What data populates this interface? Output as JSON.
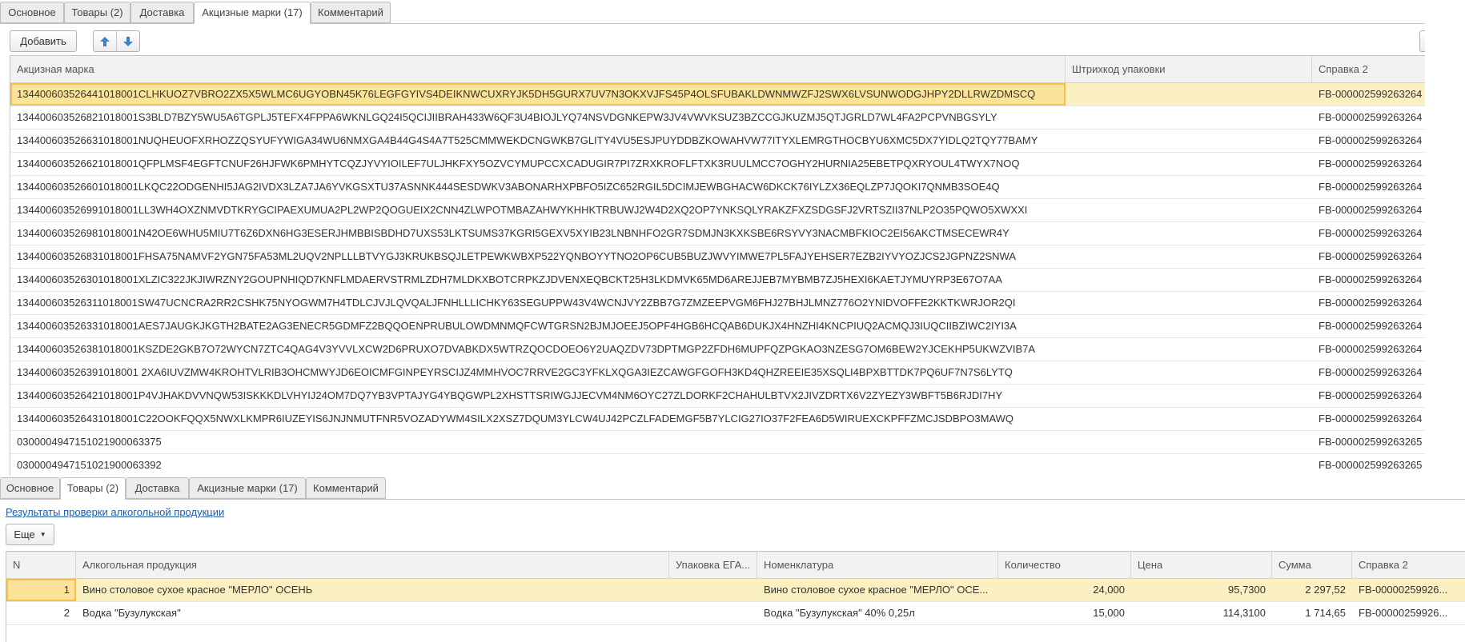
{
  "top": {
    "tabs": [
      "Основное",
      "Товары (2)",
      "Доставка",
      "Акцизные марки (17)",
      "Комментарий"
    ],
    "add_label": "Добавить",
    "icons": {
      "up": "arrow-up-icon",
      "down": "arrow-down-icon"
    },
    "columns": {
      "mark": "Акцизная марка",
      "barcode": "Штрихкод упаковки",
      "ref": "Справка 2"
    },
    "rows": [
      {
        "mark": "134400603526441018001CLHKUOZ7VBRO2ZX5X5WLMC6UGYOBN45K76LEGFGYIVS4DEIKNWCUXRYJK5DH5GURX7UV7N3OKXVJFS45P4OLSFUBAKLDWNMWZFJ2SWX6LVSUNWODGJHPY2DLLRWZDMSCQ",
        "barcode": "",
        "ref": "FB-000002599263264"
      },
      {
        "mark": "134400603526821018001S3BLD7BZY5WU5A6TGPLJ5TEFX4FPPA6WKNLGQ24I5QCIJIIBRAH433W6QF3U4BIOJLYQ74NSVDGNKEPW3JV4VWVKSUZ3BZCCGJKUZMJ5QTJGRLD7WL4FA2PCPVNBGSYLY",
        "barcode": "",
        "ref": "FB-000002599263264"
      },
      {
        "mark": "134400603526631018001NUQHEUOFXRHOZZQSYUFYWIGA34WU6NMXGA4B44G4S4A7T525CMMWEKDCNGWKB7GLITY4VU5ESJPUYDDBZKOWAHVW77ITYXLEMRGTHOCBYU6XMC5DX7YIDLQ2TQY77BAMY",
        "barcode": "",
        "ref": "FB-000002599263264"
      },
      {
        "mark": "134400603526621018001QFPLMSF4EGFTCNUF26HJFWK6PMHYTCQZJYVYIOILEF7ULJHKFXY5OZVCYMUPCCXCADUGIR7PI7ZRXKROFLFTXK3RUULMCC7OGHY2HURNIA25EBETPQXRYOUL4TWYX7NOQ",
        "barcode": "",
        "ref": "FB-000002599263264"
      },
      {
        "mark": "134400603526601018001LKQC22ODGENHI5JAG2IVDX3LZA7JA6YVKGSXTU37ASNNK444SESDWKV3ABONARHXPBFO5IZC652RGIL5DCIMJEWBGHACW6DKCK76IYLZX36EQLZP7JQOKI7QNMB3SOE4Q",
        "barcode": "",
        "ref": "FB-000002599263264"
      },
      {
        "mark": "134400603526991018001LL3WH4OXZNMVDTKRYGCIPAEXUMUA2PL2WP2QOGUEIX2CNN4ZLWPOTMBAZAHWYKHHKTRBUWJ2W4D2XQ2OP7YNKSQLYRAKZFXZSDGSFJ2VRTSZII37NLP2O35PQWO5XWXXI",
        "barcode": "",
        "ref": "FB-000002599263264"
      },
      {
        "mark": "134400603526981018001N42OE6WHU5MIU7T6Z6DXN6HG3ESERJHMBBISBDHD7UXS53LKTSUMS37KGRI5GEXV5XYIB23LNBNHFO2GR7SDMJN3KXKSBE6RSYVY3NACMBFKIOC2EI56AKCTMSECEWR4Y",
        "barcode": "",
        "ref": "FB-000002599263264"
      },
      {
        "mark": "134400603526831018001FHSA75NAMVF2YGN75FA53ML2UQV2NPLLLBTVYGJ3KRUKBSQJLETPEWKWBXP522YQNBOYYTNO2OP6CUB5BUZJWVYIMWE7PL5FAJYEHSER7EZB2IYVYOZJCS2JGPNZ2SNWA",
        "barcode": "",
        "ref": "FB-000002599263264"
      },
      {
        "mark": "134400603526301018001XLZIC322JKJIWRZNY2GOUPNHIQD7KNFLMDAERVSTRMLZDH7MLDKXBOTCRPKZJDVENXEQBCKT25H3LKDMVK65MD6AREJJEB7MYBMB7ZJ5HEXI6KAETJYMUYRP3E67O7AA",
        "barcode": "",
        "ref": "FB-000002599263264"
      },
      {
        "mark": "134400603526311018001SW47UCNCRA2RR2CSHK75NYOGWM7H4TDLCJVJLQVQALJFNHLLLICHKY63SEGUPPW43V4WCNJVY2ZBB7G7ZMZEEPVGM6FHJ27BHJLMNZ776O2YNIDVOFFE2KKTKWRJOR2QI",
        "barcode": "",
        "ref": "FB-000002599263264"
      },
      {
        "mark": "134400603526331018001AES7JAUGKJKGTH2BATE2AG3ENECR5GDMFZ2BQQOENPRUBULOWDMNMQFCWTGRSN2BJMJOEEJ5OPF4HGB6HCQAB6DUKJX4HNZHI4KNCPIUQ2ACMQJ3IUQCIIBZIWC2IYI3A",
        "barcode": "",
        "ref": "FB-000002599263264"
      },
      {
        "mark": "134400603526381018001KSZDE2GKB7O72WYCN7ZTC4QAG4V3YVVLXCW2D6PRUXO7DVABKDX5WTRZQOCDOEO6Y2UAQZDV73DPTMGP2ZFDH6MUPFQZPGKAO3NZESG7OM6BEW2YJCEKHP5UKWZVIB7A",
        "barcode": "",
        "ref": "FB-000002599263264"
      },
      {
        "mark": "134400603526391018001 2XA6IUVZMW4KROHTVLRIB3OHCMWYJD6EOICMFGINPEYRSCIJZ4MMHVOC7RRVE2GC3YFKLXQGA3IEZCAWGFGOFH3KD4QHZREEIE35XSQLI4BPXBTTDK7PQ6UF7N7S6LYTQ",
        "barcode": "",
        "ref": "FB-000002599263264"
      },
      {
        "mark": "134400603526421018001P4VJHAKDVVNQW53ISKKKDLVHYIJ24OM7DQ7YB3VPTAJYG4YBQGWPL2XHSTTSRIWGJJECVM4NM6OYC27ZLDORKF2CHAHULBTVX2JIVZDRTX6V2ZYEZY3WBFT5B6RJDI7HY",
        "barcode": "",
        "ref": "FB-000002599263264"
      },
      {
        "mark": "134400603526431018001C22OOKFQQX5NWXLKMPR6IUZEYIS6JNJNMUTFNR5VOZADYWM4SILX2XSZ7DQUM3YLCW4UJ42PCZLFADEMGF5B7YLCIG27IO37F2FEA6D5WIRUEXCKPFFZMCJSDBPO3MAWQ",
        "barcode": "",
        "ref": "FB-000002599263264"
      },
      {
        "mark": "0300004947151021900063375",
        "barcode": "",
        "ref": "FB-000002599263265"
      },
      {
        "mark": "0300004947151021900063392",
        "barcode": "",
        "ref": "FB-000002599263265"
      }
    ]
  },
  "bottom": {
    "tabs": [
      "Основное",
      "Товары (2)",
      "Доставка",
      "Акцизные марки (17)",
      "Комментарий"
    ],
    "link": "Результаты проверки алкогольной продукции",
    "more_label": "Еще",
    "columns": {
      "n": "N",
      "product": "Алкогольная продукция",
      "pack": "Упаковка ЕГА...",
      "nom": "Номенклатура",
      "qty": "Количество",
      "price": "Цена",
      "sum": "Сумма",
      "ref": "Справка 2"
    },
    "rows": [
      {
        "n": "1",
        "product": "Вино столовое сухое красное \"МЕРЛО\" ОСЕНЬ",
        "pack": "",
        "nom": "Вино столовое сухое красное \"МЕРЛО\" ОСЕ...",
        "qty": "24,000",
        "price": "95,7300",
        "sum": "2 297,52",
        "ref": "FB-00000259926..."
      },
      {
        "n": "2",
        "product": "Водка \"Бузулукская\"",
        "pack": "",
        "nom": "Водка \"Бузулукская\"  40% 0,25л",
        "qty": "15,000",
        "price": "114,3100",
        "sum": "1 714,65",
        "ref": "FB-00000259926..."
      }
    ]
  }
}
